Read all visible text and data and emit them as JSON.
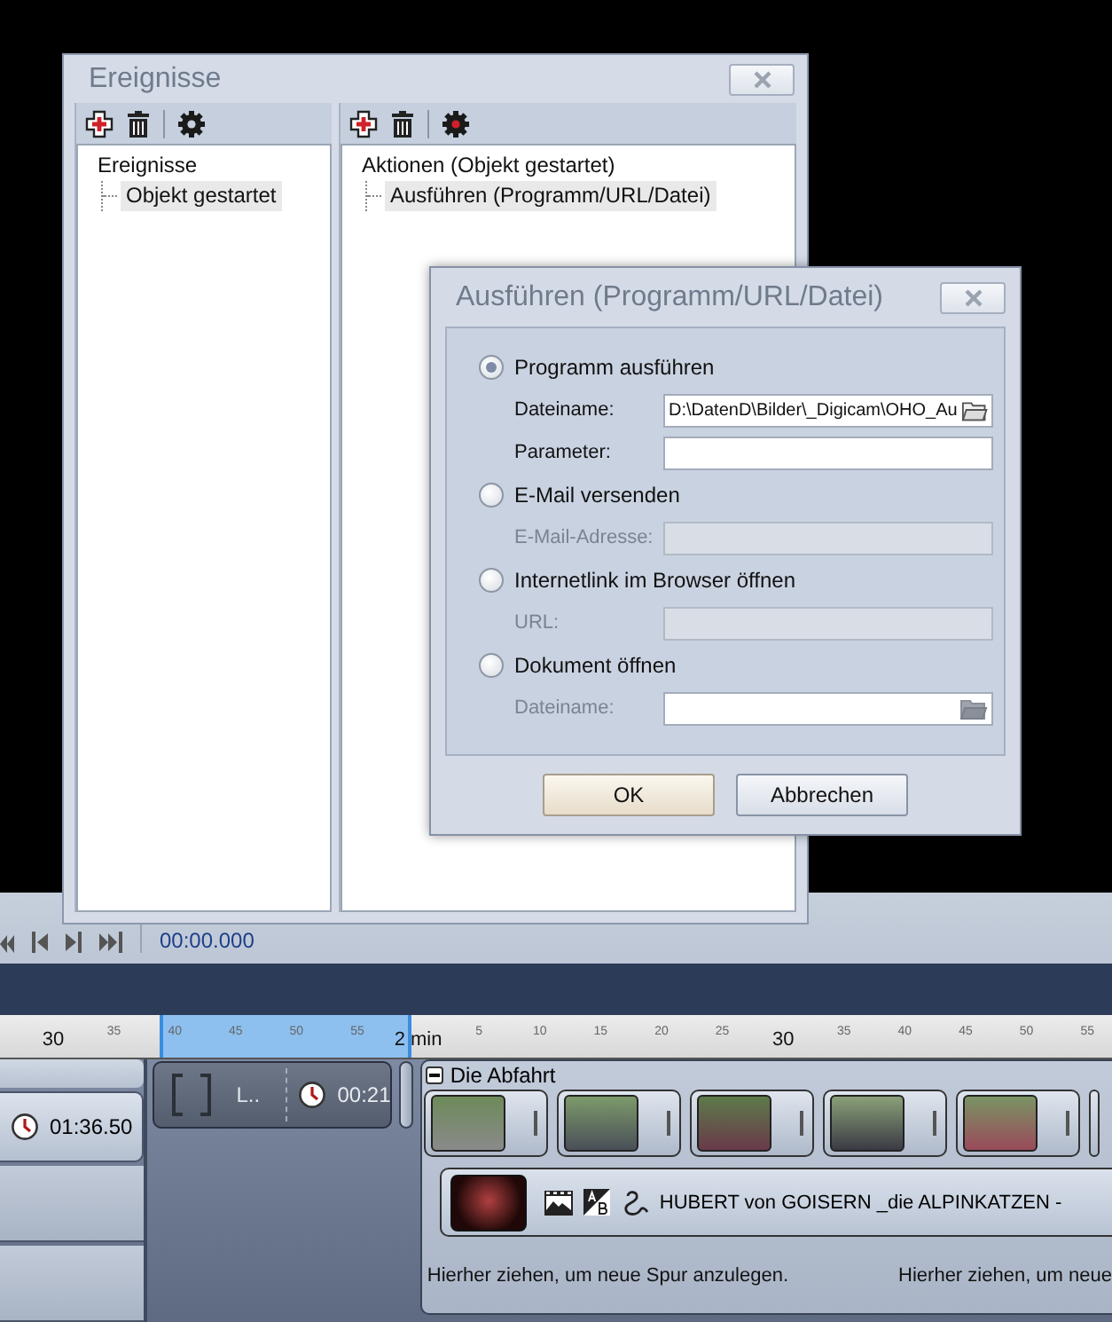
{
  "events_window": {
    "title": "Ereignisse",
    "panes": [
      {
        "tree": [
          {
            "label": "Ereignisse",
            "selected": false,
            "children": [
              {
                "label": "Objekt gestartet",
                "selected": true
              }
            ]
          }
        ]
      },
      {
        "tree": [
          {
            "label": "Aktionen (Objekt gestartet)",
            "selected": false,
            "children": [
              {
                "label": "Ausführen (Programm/URL/Datei)",
                "selected": true
              }
            ]
          }
        ]
      }
    ]
  },
  "exec_dialog": {
    "title": "Ausführen (Programm/URL/Datei)",
    "options": [
      {
        "label": "Programm ausführen",
        "selected": true,
        "fields": [
          {
            "label": "Dateiname:",
            "value": "D:\\DatenD\\Bilder\\_Digicam\\OHO_Au",
            "browse": true,
            "disabled": false
          },
          {
            "label": "Parameter:",
            "browse": false,
            "disabled": false
          }
        ]
      },
      {
        "label": "E-Mail versenden",
        "selected": false,
        "fields": [
          {
            "label": "E-Mail-Adresse:",
            "browse": false,
            "disabled": true
          }
        ]
      },
      {
        "label": "Internetlink im Browser öffnen",
        "selected": false,
        "fields": [
          {
            "label": "URL:",
            "browse": false,
            "disabled": true
          }
        ]
      },
      {
        "label": "Dokument öffnen",
        "selected": false,
        "fields": [
          {
            "label": "Dateiname:",
            "browse": true,
            "disabled": true
          }
        ]
      }
    ],
    "buttons": [
      {
        "label": "OK",
        "default": true
      },
      {
        "label": "Abbrechen",
        "default": false
      }
    ]
  },
  "transport": {
    "time": "00:00.000"
  },
  "ruler": {
    "ticks": [
      {
        "label": "30",
        "major": true
      },
      {
        "label": "35",
        "major": false
      },
      {
        "label": "40",
        "major": false
      },
      {
        "label": "45",
        "major": false
      },
      {
        "label": "50",
        "major": false
      },
      {
        "label": "55",
        "major": false
      },
      {
        "label": "2 min",
        "major": true
      },
      {
        "label": "5",
        "major": false
      },
      {
        "label": "10",
        "major": false
      },
      {
        "label": "15",
        "major": false
      },
      {
        "label": "20",
        "major": false
      },
      {
        "label": "25",
        "major": false
      },
      {
        "label": "30",
        "major": true
      },
      {
        "label": "35",
        "major": false
      },
      {
        "label": "40",
        "major": false
      },
      {
        "label": "45",
        "major": false
      },
      {
        "label": "50",
        "major": false
      },
      {
        "label": "55",
        "major": false
      }
    ]
  },
  "timeline": {
    "left_clip": {
      "duration": "01:36.50"
    },
    "middle_clip": {
      "label": "L..",
      "duration": "00:21"
    },
    "group": {
      "title": "Die Abfahrt",
      "expanded": true,
      "audio": {
        "title": "HUBERT von GOISERN _die ALPINKATZEN -"
      },
      "hints": [
        "Hierher ziehen, um neue Spur anzulegen.",
        "Hierher ziehen, um neue"
      ]
    }
  }
}
